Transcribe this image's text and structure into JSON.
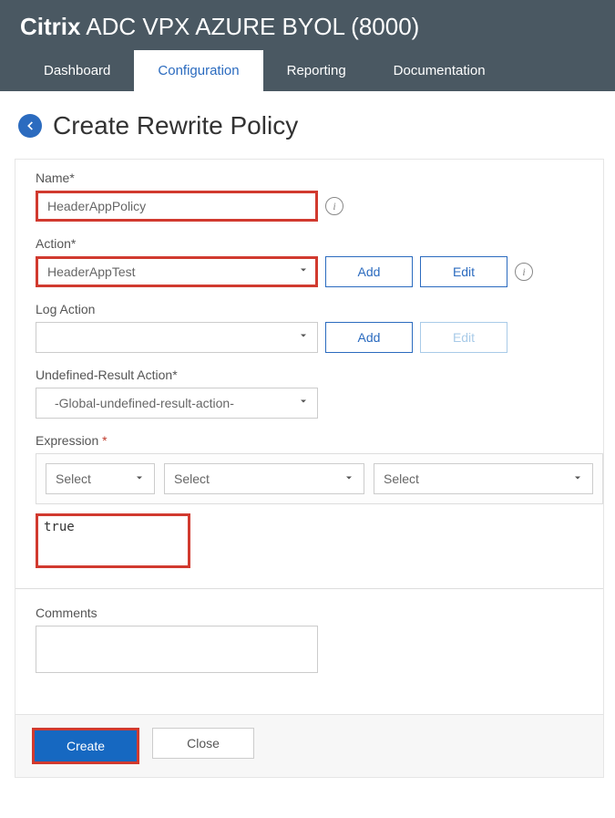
{
  "header": {
    "brand_bold": "Citrix",
    "brand_rest": " ADC VPX AZURE BYOL (8000)"
  },
  "tabs": [
    {
      "label": "Dashboard",
      "active": false
    },
    {
      "label": "Configuration",
      "active": true
    },
    {
      "label": "Reporting",
      "active": false
    },
    {
      "label": "Documentation",
      "active": false
    }
  ],
  "page": {
    "title": "Create Rewrite Policy"
  },
  "form": {
    "name": {
      "label": "Name*",
      "value": "HeaderAppPolicy"
    },
    "action": {
      "label": "Action*",
      "value": "HeaderAppTest",
      "add": "Add",
      "edit": "Edit"
    },
    "log_action": {
      "label": "Log Action",
      "value": "",
      "add": "Add",
      "edit": "Edit"
    },
    "undefined_action": {
      "label": "Undefined-Result Action*",
      "value": "-Global-undefined-result-action-"
    },
    "expression": {
      "label": "Expression ",
      "star": "*",
      "select_placeholder": "Select",
      "value": "true"
    },
    "comments": {
      "label": "Comments",
      "value": ""
    }
  },
  "footer": {
    "create": "Create",
    "close": "Close"
  }
}
